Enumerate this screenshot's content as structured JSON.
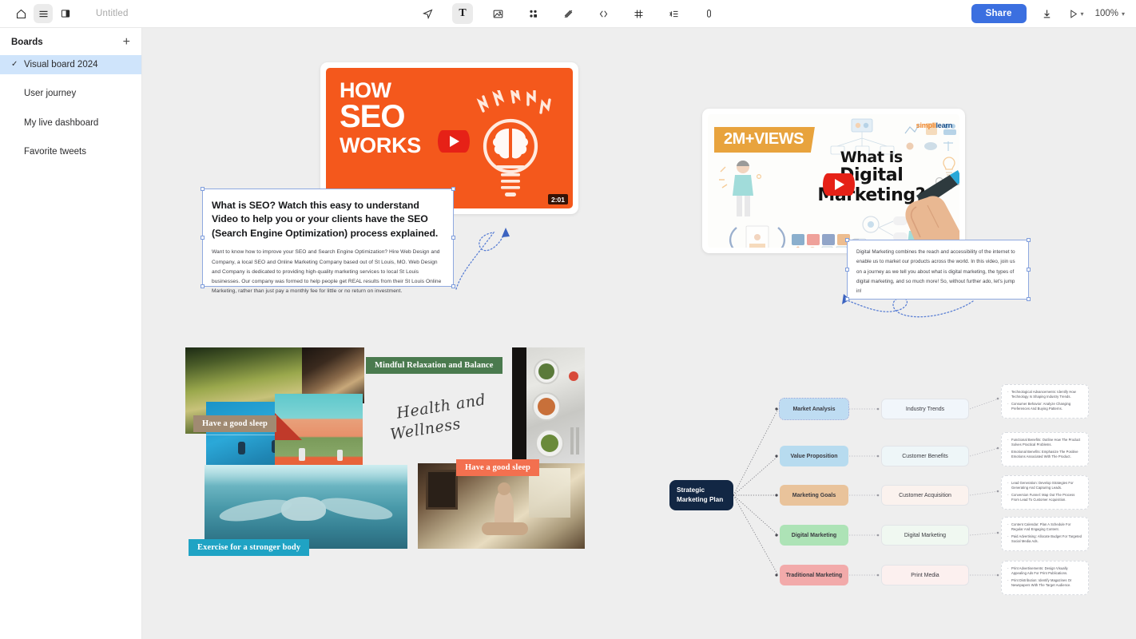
{
  "window": {
    "doc_title": "Untitled"
  },
  "topbar": {
    "left_icons": [
      {
        "name": "home-icon",
        "glyph": "home"
      },
      {
        "name": "hamburger-menu-icon",
        "glyph": "menu"
      },
      {
        "name": "panel-toggle-icon",
        "glyph": "panel"
      }
    ],
    "tools": [
      {
        "name": "select-cursor-tool",
        "label": "cursor-icon",
        "active": false
      },
      {
        "name": "text-tool",
        "label": "T",
        "active": true
      },
      {
        "name": "image-tool",
        "label": "image-icon",
        "active": false
      },
      {
        "name": "components-tool",
        "label": "shapes-icon",
        "active": false
      },
      {
        "name": "draw-pen-tool",
        "label": "pen-icon",
        "active": false
      },
      {
        "name": "embed-code-tool",
        "label": "code-icon",
        "active": false
      },
      {
        "name": "frame-tool",
        "label": "hash-icon",
        "active": false
      },
      {
        "name": "mindmap-tool",
        "label": "list-tree-icon",
        "active": false
      },
      {
        "name": "attachment-tool",
        "label": "paperclip-icon",
        "active": false
      }
    ],
    "share_label": "Share",
    "download_icon": "download-icon",
    "present_icon": "play-icon",
    "zoom_level": "100%",
    "accent_color": "#3b6fe0"
  },
  "sidebar": {
    "header": "Boards",
    "add_label": "+",
    "items": [
      {
        "label": "Visual board 2024",
        "selected": true
      },
      {
        "label": "User journey",
        "selected": false
      },
      {
        "label": "My live dashboard",
        "selected": false
      },
      {
        "label": "Favorite tweets",
        "selected": false
      }
    ]
  },
  "canvas": {
    "background_color": "#eeeeee",
    "seo_video": {
      "line1": "HOW",
      "line2": "SEO",
      "line3": "WORKS",
      "duration": "2:01",
      "bg_color": "#f4581c",
      "play_button": "youtube-play-button"
    },
    "seo_text": {
      "heading": "What is SEO? Watch this easy to understand Video to help you or your clients have the SEO (Search Engine Optimization) process explained.",
      "body": "Want to know how to improve your SEO and Search Engine Optimization? Hire Web Design and Company, a local SEO and Online Marketing Company based out of St Louis, MO.  Web Design and Company is dedicated to providing high-quality marketing services to local St Louis businesses. Our company was formed to help people get REAL results from their St Louis Online Marketing, rather than just pay a monthly fee for little or no return on investment."
    },
    "dm_video": {
      "views_badge": "2M+VIEWS",
      "title_line1": "What is",
      "title_line2": "Digital Marketing?",
      "brand": "simplilearn",
      "brand_part1": "simpli",
      "brand_part2": "learn",
      "play_button": "youtube-play-button"
    },
    "dm_text": {
      "body": "Digital Marketing combines the reach and accessibility of the internet to enable us to market our products across the world. In this video, join us on a journey as we tell you about what is digital marketing, the types of digital marketing, and so much more! So, without further ado, let's jump in!"
    },
    "collage": {
      "labels": [
        {
          "text": "Mindful Relaxation and Balance",
          "color": "#4a7a4e"
        },
        {
          "text": "Have a good sleep",
          "color": "#a08a72"
        },
        {
          "text": "Have a good sleep",
          "color": "#f3704f"
        },
        {
          "text": "Exercise for a stronger body",
          "color": "#1fa3c4"
        }
      ],
      "script_line1": "Health and",
      "script_line2": "Wellness"
    }
  },
  "mindmap": {
    "root": "Strategic Marketing Plan",
    "root_color": "#122744",
    "branches": [
      {
        "l1": "Market Analysis",
        "l1_color": "#bedcf2",
        "selected": true,
        "l2": "Industry Trends",
        "l2_color": "#f1f6fb",
        "details": [
          "Technological Advancements: Identify How Technology Is Shaping Industry Trends.",
          "Consumer Behavior: Analyze Changing Preferences And Buying Patterns."
        ]
      },
      {
        "l1": "Value Proposition",
        "l1_color": "#b7dbef",
        "selected": false,
        "l2": "Customer Benefits",
        "l2_color": "#eef6f8",
        "details": [
          "Functional Benefits: Outline How The Product Solves Practical Problems.",
          "Emotional Benefits: Emphasize The Positive Emotions Associated With The Product."
        ]
      },
      {
        "l1": "Marketing Goals",
        "l1_color": "#e9c39b",
        "selected": false,
        "l2": "Customer Acquisition",
        "l2_color": "#fbf2ee",
        "details": [
          "Lead Generation: Develop Strategies For Generating And Capturing Leads.",
          "Conversion Funnel: Map Out The Process From Lead To Customer Acquisition."
        ]
      },
      {
        "l1": "Digital Marketing",
        "l1_color": "#ade3b6",
        "selected": false,
        "l2": "Digital Marketing",
        "l2_color": "#f0f8f1",
        "details": [
          "Content Calendar: Plan A Schedule For Regular And Engaging Content.",
          "Paid Advertising: Allocate Budget For Targeted Social Media Ads."
        ]
      },
      {
        "l1": "Traditional Marketing",
        "l1_color": "#f2aaaa",
        "selected": false,
        "l2": "Print Media",
        "l2_color": "#fcf0ef",
        "details": [
          "Print Advertisements: Design Visually Appealing Ads For Print Publications.",
          "Print Distribution: Identify Magazines Or Newspapers With The Target Audience."
        ]
      }
    ]
  }
}
